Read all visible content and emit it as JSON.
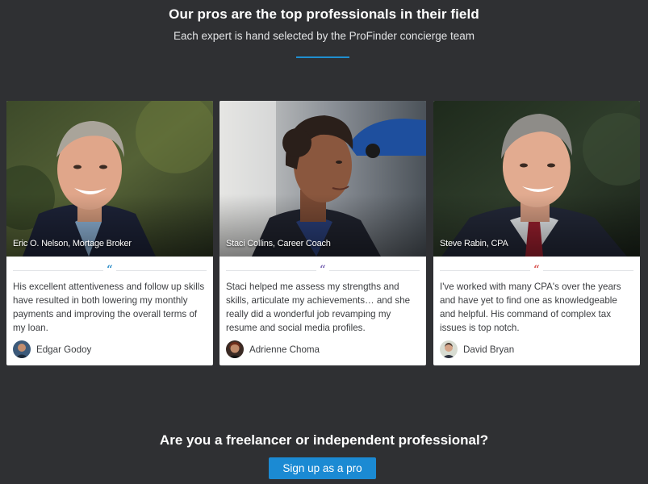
{
  "header": {
    "title": "Our pros are the top professionals in their field",
    "subtitle": "Each expert is hand selected by the ProFinder concierge team",
    "accent_color": "#1f8fd0"
  },
  "cards": [
    {
      "caption": "Eric O. Nelson, Mortage Broker",
      "quote_mark": "“",
      "quote_color": "#2f8fc9",
      "quote": "His excellent attentiveness and follow up skills have resulted in both lowering my monthly payments and improving the overall terms of my loan.",
      "reviewer": "Edgar Godoy"
    },
    {
      "caption": "Staci Collins, Career Coach",
      "quote_mark": "“",
      "quote_color": "#7b68b5",
      "quote": "Staci helped me assess my strengths and skills, articulate my achievements… and she really did a wonderful job revamping my resume and social media profiles.",
      "reviewer": "Adrienne Choma"
    },
    {
      "caption": "Steve Rabin, CPA",
      "quote_mark": "“",
      "quote_color": "#d9534f",
      "quote": "I've worked with many CPA's over the years and have yet to find one as knowledgeable and helpful. His command of complex tax issues is top notch.",
      "reviewer": "David Bryan"
    }
  ],
  "cta": {
    "heading": "Are you a freelancer or independent professional?",
    "button_label": "Sign up as a pro",
    "button_color": "#1b8ad3"
  }
}
